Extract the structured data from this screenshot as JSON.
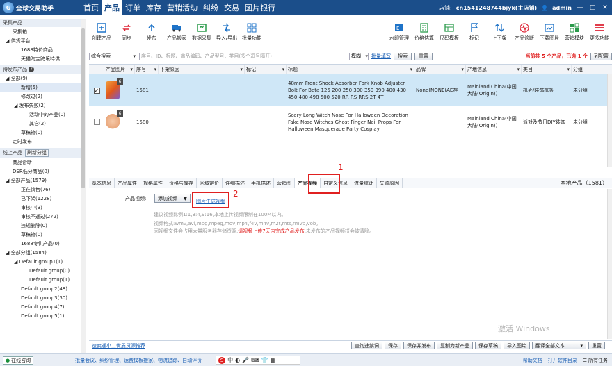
{
  "app": {
    "title": "全球交易助手",
    "store_label": "店铺:",
    "store_name": "cn1541248744bjyk(主店铺)",
    "user": "admin"
  },
  "nav": {
    "tabs": [
      "首页",
      "产品",
      "订单",
      "库存",
      "营销活动",
      "纠纷",
      "交易",
      "图片银行"
    ],
    "active": 1
  },
  "sidebar": {
    "section1": {
      "title": "采集产品",
      "items": [
        "采集箱",
        "供货平台",
        "1688特价商品",
        "天猫淘宝跨境特供"
      ]
    },
    "section2": {
      "title": "待发布产品",
      "items": [
        "全部(9)",
        "新增(5)",
        "修改过(2)",
        "发布失败(2)",
        "活动中的产品(0)",
        "其它(2)",
        "草稿箱(0)",
        "定时发布"
      ]
    },
    "section3": {
      "title": "线上产品",
      "refresh_label": "刷新分组",
      "items": [
        "商品诊断",
        "DSR低分商品(0)",
        "全部产品(1579)",
        "正在销售(76)",
        "已下架(1228)",
        "审核中(3)",
        "审核不通过(272)",
        "违规删除(0)",
        "草稿箱(0)",
        "1688专供产品(0)",
        "全部分组(1584)",
        "Default group1(1)",
        "Default group(0)",
        "Default group(1)",
        "Default group2(48)",
        "Default group3(30)",
        "Default group4(7)",
        "Default group5(1)"
      ]
    }
  },
  "toolbar": {
    "left": [
      "创建产品",
      "同步",
      "发布",
      "产品搬家",
      "数据采集",
      "导入/导出",
      "批量功能"
    ],
    "right": [
      "水印管理",
      "价格估算",
      "尺码模板",
      "标记",
      "上下架",
      "产品诊断",
      "下载图片",
      "营销模块",
      "更多功能"
    ]
  },
  "search": {
    "search_type": "综合搜索",
    "placeholder": "序号、ID、标题、商品编码、产品型号、类目(多个逗号隔开)",
    "match": "模糊",
    "batch_fill": "批量填写",
    "search_btn": "搜索",
    "reset_btn": "重置",
    "stats_prefix": "当前共",
    "total": "5",
    "stats_mid": "个产品，已选",
    "selected": "1",
    "stats_suffix": "个",
    "col_config": "列配置"
  },
  "table": {
    "headers": [
      "产品图片",
      "序号",
      "下架原因",
      "标记",
      "标题",
      "品牌",
      "产地信息",
      "类目",
      "分组"
    ],
    "rows": [
      {
        "selected": true,
        "badge": "6",
        "seq": "1581",
        "reason": "",
        "mark": "",
        "title": "48mm Front Shock Absorber Fork Knob Adjuster Bolt For Beta 125 200 250 300 350 390 400 430 450 480 498 500 520 RR RS RRS 2T 4T",
        "brand": "None(NONE(AE存",
        "origin": "Mainland China(中国大陆(Origin))",
        "category": "机壳/装饰框条",
        "group": "未分组"
      },
      {
        "selected": false,
        "badge": "6",
        "seq": "1580",
        "reason": "",
        "mark": "",
        "title": "Scary Long Witch Nose For Halloween Decoration Fake Nose Witches Ghost Finger Nail Props For Halloween Masquerade Party Cosplay",
        "brand": "",
        "origin": "Mainland China(中国大陆(Origin))",
        "category": "派对及节日DIY装饰",
        "group": "未分组"
      }
    ]
  },
  "tabs": {
    "items": [
      "基本信息",
      "产品属性",
      "规格属性",
      "价格与库存",
      "区域定价",
      "详细描述",
      "手机描述",
      "营销图",
      "产品视频",
      "自定义信息",
      "流量统计",
      "失败原因"
    ],
    "active": 8,
    "local_product_prefix": "本地产品（",
    "local_product_num": "1581",
    "local_product_suffix": "）"
  },
  "video_panel": {
    "label": "产品视频:",
    "add_btn": "添加视频",
    "gen_link": "图片生成视频",
    "note1": "建议视频比例1:1,3:4,9:16,本地上传视频限制在100M以内。",
    "note2": "视频格式:wmv,avi,mpg,mpeg,mov,mp4,f4v,m4v,m2t,mts,rmvb,vob。",
    "note3a": "因视频文件会占用大量服务器存储资源,",
    "note3_red": "请视频上传7天内完成产品发布",
    "note3b": ",未发布的产品视频将会被清除。"
  },
  "annotations": {
    "mark1": "1",
    "mark2": "2"
  },
  "footer": {
    "link": "速卖通小二优质货源推荐",
    "buttons": [
      "查询违禁词",
      "保存",
      "保存并发布",
      "复制为新产品",
      "保存草稿",
      "导入图片",
      "翻译全部文本",
      "重置"
    ],
    "watermark": "激活 Windows"
  },
  "status": {
    "online": "在线咨询",
    "links": [
      "批量会议、纠纷管理、运费模板搬家、物流追踪、自动评价"
    ],
    "help": "帮助文档",
    "open_dir": "打开软件目录",
    "tasks": "所有任务"
  },
  "colors": {
    "nav_bg": "#1b4e8a",
    "accent_red": "#e02020",
    "selected_row": "#cfe7f7"
  }
}
